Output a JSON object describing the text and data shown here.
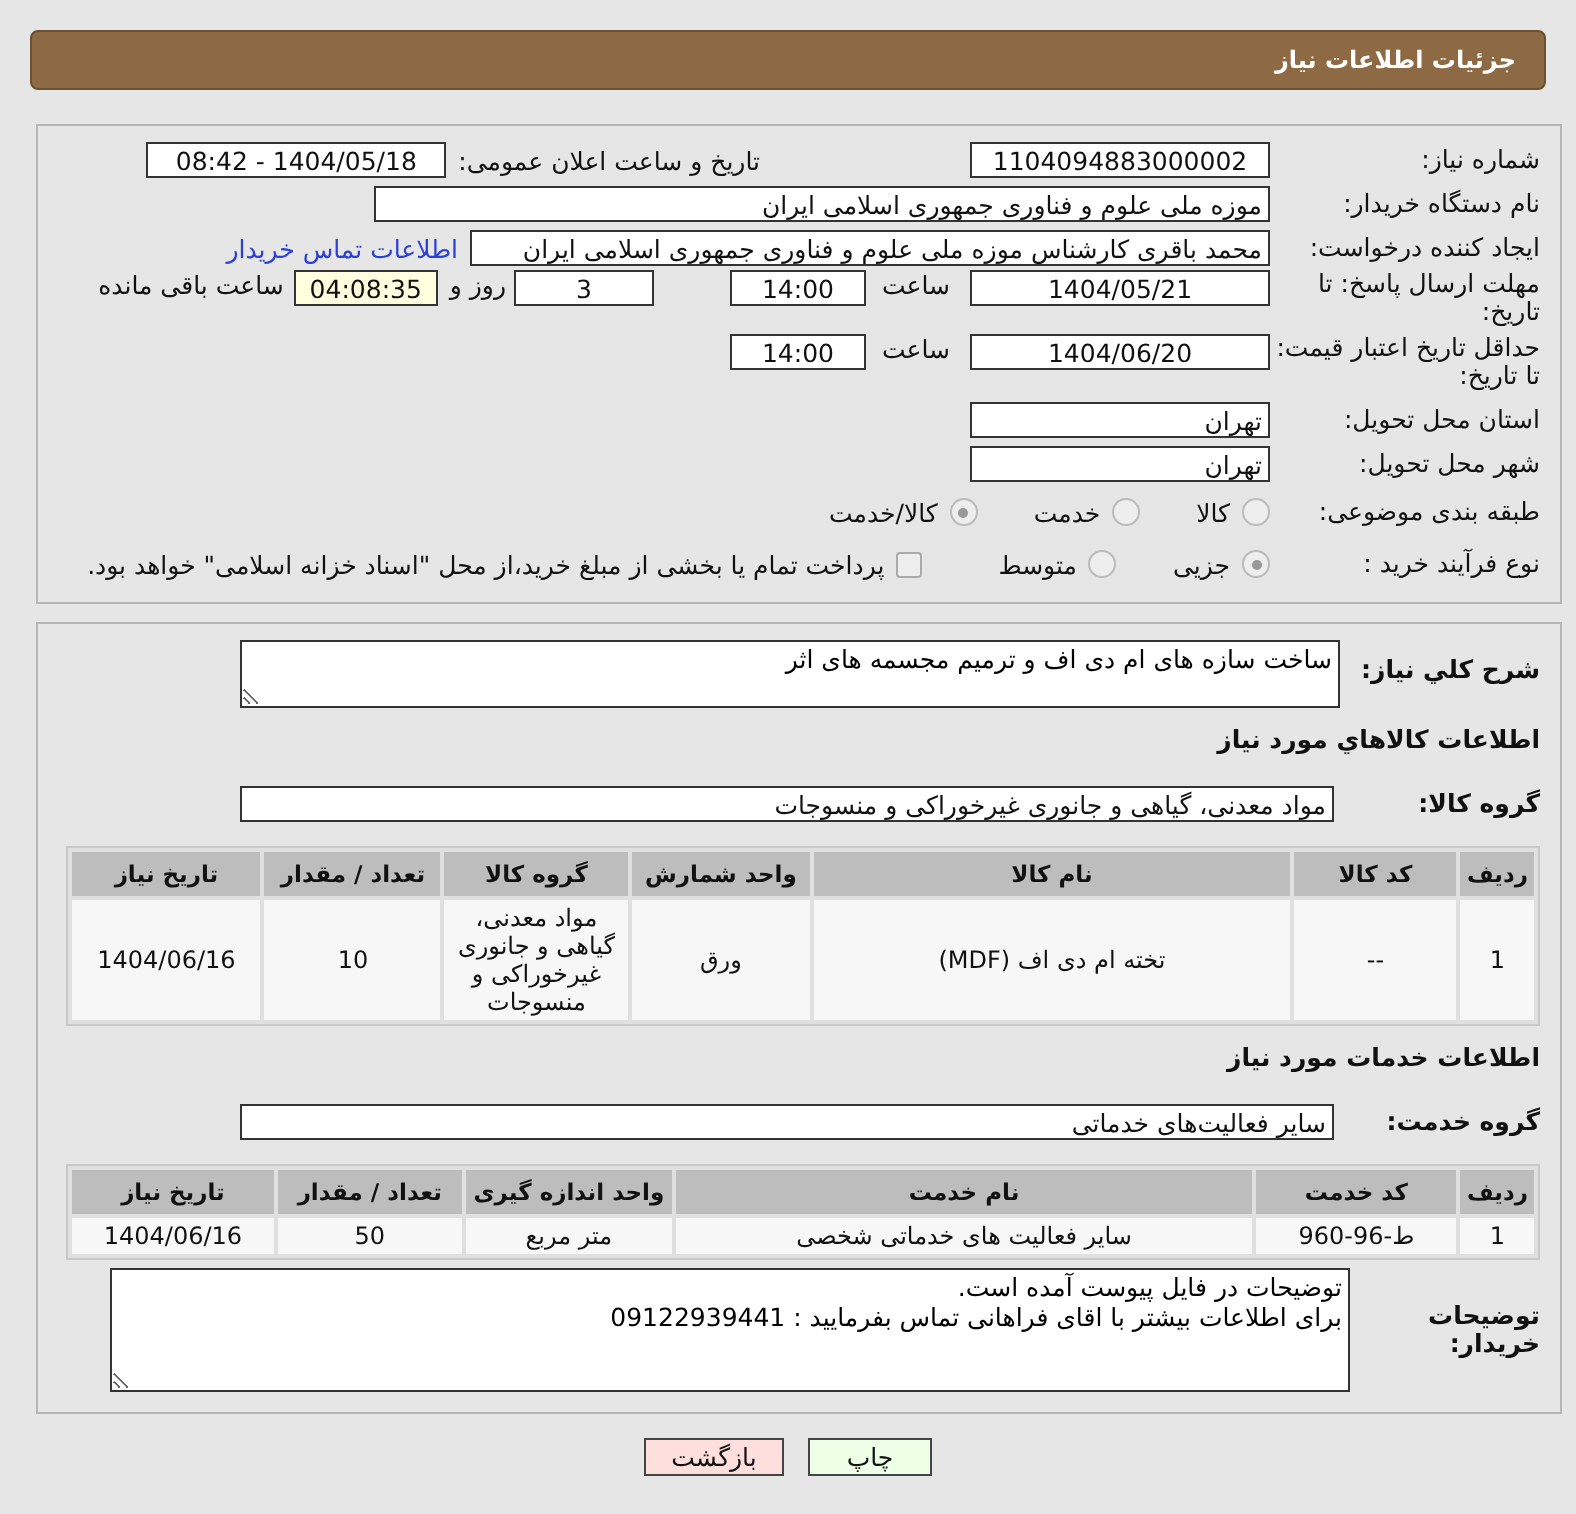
{
  "header": {
    "title": "جزئیات اطلاعات نیاز"
  },
  "need_number": {
    "label": "شماره نیاز:",
    "value": "1104094883000002"
  },
  "announce": {
    "label": "تاریخ و ساعت اعلان عمومی:",
    "value": "1404/05/18 - 08:42"
  },
  "buyer": {
    "label": "نام دستگاه خریدار:",
    "value": "موزه ملی علوم و فناوری جمهوری اسلامی ایران"
  },
  "creator": {
    "label": "ایجاد کننده درخواست:",
    "value": "محمد  باقری کارشناس  موزه ملی علوم و فناوری جمهوری اسلامی ایران",
    "link": "اطلاعات تماس خریدار"
  },
  "deadline": {
    "label": "مهلت ارسال پاسخ: تا تاریخ:",
    "date": "1404/05/21",
    "time_label": "ساعت",
    "time": "14:00",
    "days": "3",
    "days_label": "روز و",
    "remaining": "04:08:35",
    "remaining_label": "ساعت باقی مانده"
  },
  "validity": {
    "label": "حداقل تاریخ اعتبار قیمت: تا تاریخ:",
    "date": "1404/06/20",
    "time_label": "ساعت",
    "time": "14:00"
  },
  "province": {
    "label": "استان محل تحویل:",
    "value": "تهران"
  },
  "city": {
    "label": "شهر محل تحویل:",
    "value": "تهران"
  },
  "category": {
    "label": "طبقه بندی موضوعی:",
    "options": [
      {
        "label": "کالا",
        "selected": false
      },
      {
        "label": "خدمت",
        "selected": false
      },
      {
        "label": "کالا/خدمت",
        "selected": true
      }
    ]
  },
  "process": {
    "label": "نوع فرآیند خرید :",
    "options": [
      {
        "label": "جزیی",
        "selected": true
      },
      {
        "label": "متوسط",
        "selected": false
      }
    ],
    "treasury": {
      "label": "پرداخت تمام یا بخشی از مبلغ خرید،از محل \"اسناد خزانه اسلامی\" خواهد بود.",
      "checked": false
    }
  },
  "description": {
    "label": "شرح کلي نياز:",
    "value": "ساخت سازه های ام دی اف و ترمیم مجسمه های اثر"
  },
  "goods": {
    "heading": "اطلاعات کالاهاي مورد نياز",
    "group_label": "گروه کالا:",
    "group": "مواد معدنی، گیاهی و جانوری غیرخوراکی و منسوجات",
    "columns": [
      "ردیف",
      "کد کالا",
      "نام کالا",
      "واحد شمارش",
      "گروه کالا",
      "تعداد / مقدار",
      "تاریخ نیاز"
    ],
    "rows": [
      [
        "1",
        "--",
        "تخته ام دی اف (MDF)",
        "ورق",
        "مواد معدنی، گیاهی و جانوری غیرخوراکی و منسوجات",
        "10",
        "1404/06/16"
      ]
    ]
  },
  "services": {
    "heading": "اطلاعات خدمات مورد نياز",
    "group_label": "گروه خدمت:",
    "group": "سایر فعالیت‌های خدماتی",
    "columns": [
      "ردیف",
      "کد خدمت",
      "نام خدمت",
      "واحد اندازه گیری",
      "تعداد / مقدار",
      "تاریخ نیاز"
    ],
    "rows": [
      [
        "1",
        "ط-96-960",
        "سایر فعالیت های خدماتی شخصی",
        "متر مربع",
        "50",
        "1404/06/16"
      ]
    ]
  },
  "notes": {
    "label": "توضیحات خریدار:",
    "value": "توضیحات در فایل پیوست آمده است.\nبرای اطلاعات بیشتر با اقای فراهانی تماس بفرمایید : 09122939441"
  },
  "buttons": [
    {
      "label": "چاپ",
      "kind": "print"
    },
    {
      "label": "بازگشت",
      "kind": "back"
    }
  ]
}
